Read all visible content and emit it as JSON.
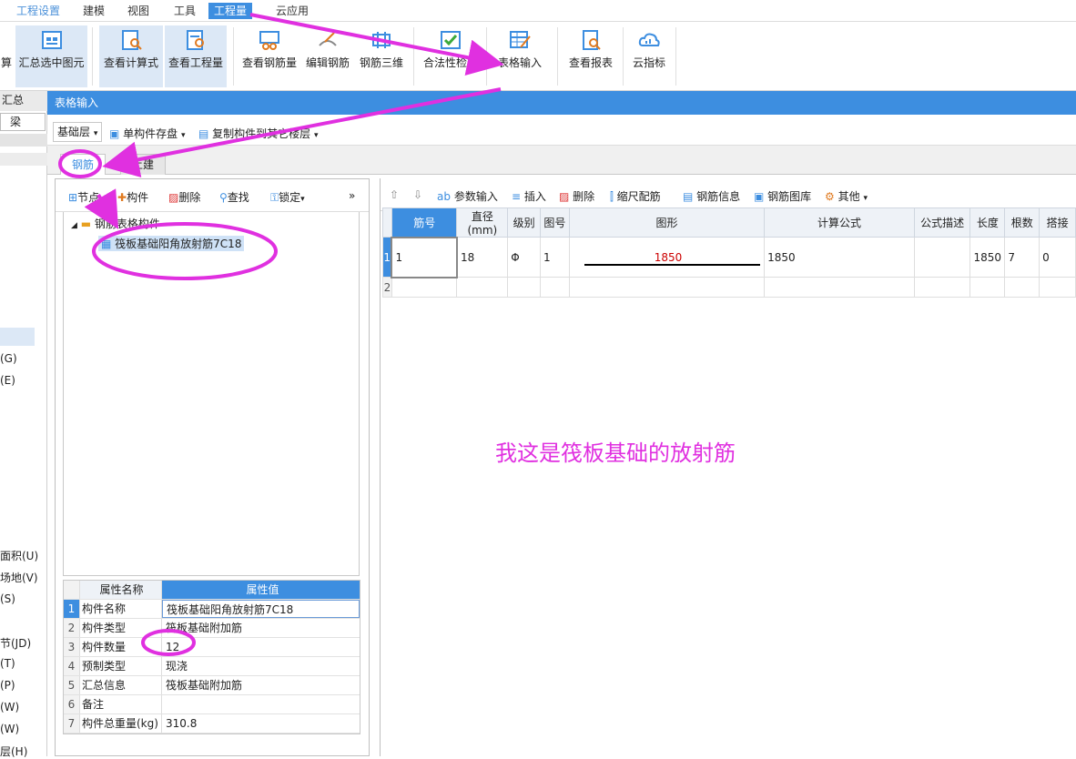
{
  "menu": [
    "工程设置",
    "建模",
    "视图",
    "工具",
    "工程量",
    "云应用"
  ],
  "ribbon": {
    "calc_partial": "算",
    "buttons": [
      "汇总选中图元",
      "查看计算式",
      "查看工程量",
      "查看钢筋量",
      "编辑钢筋",
      "钢筋三维",
      "合法性检查",
      "表格输入",
      "查看报表",
      "云指标"
    ]
  },
  "left_strip": {
    "header": "汇总",
    "field": "梁",
    "items": [
      "(G)",
      "(E)",
      "面积(U)",
      "场地(V)",
      "(S)",
      "节(JD)",
      "(T)",
      "(P)",
      "(W)",
      "(W)",
      "层(H)"
    ]
  },
  "window": {
    "title": "表格输入",
    "floor_select": "基础层",
    "save_single": "单构件存盘",
    "copy_other": "复制构件到其它楼层"
  },
  "tabs": [
    "钢筋",
    "土建"
  ],
  "left_tools": [
    "节点",
    "构件",
    "删除",
    "查找",
    "锁定"
  ],
  "tree": {
    "root": "钢筋表格构件",
    "child": "筏板基础阳角放射筋7C18"
  },
  "props": {
    "headers": [
      "属性名称",
      "属性值"
    ],
    "rows": [
      {
        "n": "1",
        "k": "构件名称",
        "v": "筏板基础阳角放射筋7C18"
      },
      {
        "n": "2",
        "k": "构件类型",
        "v": "筏板基础附加筋"
      },
      {
        "n": "3",
        "k": "构件数量",
        "v": "12"
      },
      {
        "n": "4",
        "k": "预制类型",
        "v": "现浇"
      },
      {
        "n": "5",
        "k": "汇总信息",
        "v": "筏板基础附加筋"
      },
      {
        "n": "6",
        "k": "备注",
        "v": ""
      },
      {
        "n": "7",
        "k": "构件总重量(kg)",
        "v": "310.8"
      }
    ]
  },
  "right_tools": [
    "参数输入",
    "插入",
    "删除",
    "缩尺配筋",
    "钢筋信息",
    "钢筋图库",
    "其他"
  ],
  "grid": {
    "headers": [
      "筋号",
      "直径(mm)",
      "级别",
      "图号",
      "图形",
      "计算公式",
      "公式描述",
      "长度",
      "根数",
      "搭接"
    ],
    "row1": {
      "n": "1",
      "no": "1",
      "dia": "18",
      "grade": "Φ",
      "fig": "1",
      "shape": "1850",
      "formula": "1850",
      "desc": "",
      "len": "1850",
      "count": "7",
      "lap": "0"
    },
    "row2": {
      "n": "2"
    }
  },
  "annotation": "我这是筏板基础的放射筋",
  "colors": {
    "accent": "#3d8ee0",
    "annotation": "#e030e0"
  }
}
